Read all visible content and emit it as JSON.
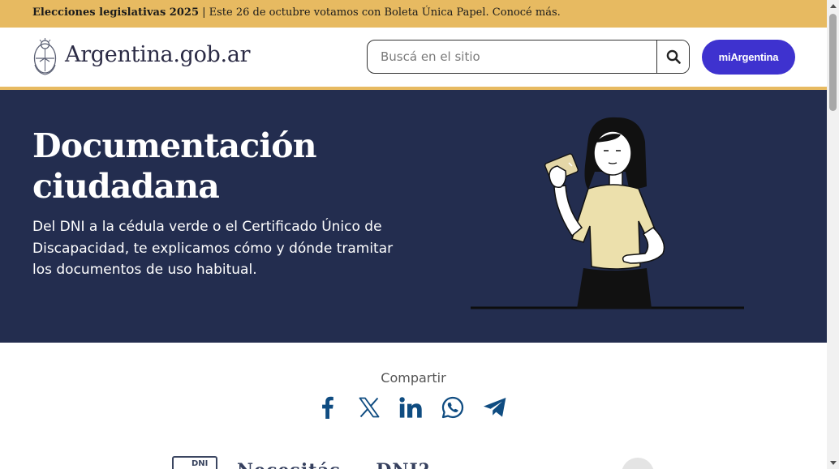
{
  "announcement": {
    "bold_text": "Elecciones legislativas 2025",
    "text": " | Este 26 de octubre votamos con Boleta Única Papel. Conocé más."
  },
  "header": {
    "brand": "Argentina.gob.ar",
    "search_placeholder": "Buscá en el sitio",
    "search_icon": "search-icon",
    "account_button": "miArgentina"
  },
  "hero": {
    "title_line1": "Documentación",
    "title_line2": "ciudadana",
    "description": "Del DNI a la cédula verde o el Certificado Único de Discapacidad, te explicamos cómo y dónde tramitar los documentos de uso habitual."
  },
  "share": {
    "label": "Compartir",
    "icons": [
      "facebook-icon",
      "x-icon",
      "linkedin-icon",
      "whatsapp-icon",
      "telegram-icon"
    ]
  },
  "section_preview": {
    "card_label": "DNI",
    "heading": "Necesitás ... DNI?"
  },
  "colors": {
    "announcement_bg": "#e7ba61",
    "hero_bg": "#232d4f",
    "account_button_bg": "#3e32cf",
    "share_icon": "#0f4c81"
  }
}
